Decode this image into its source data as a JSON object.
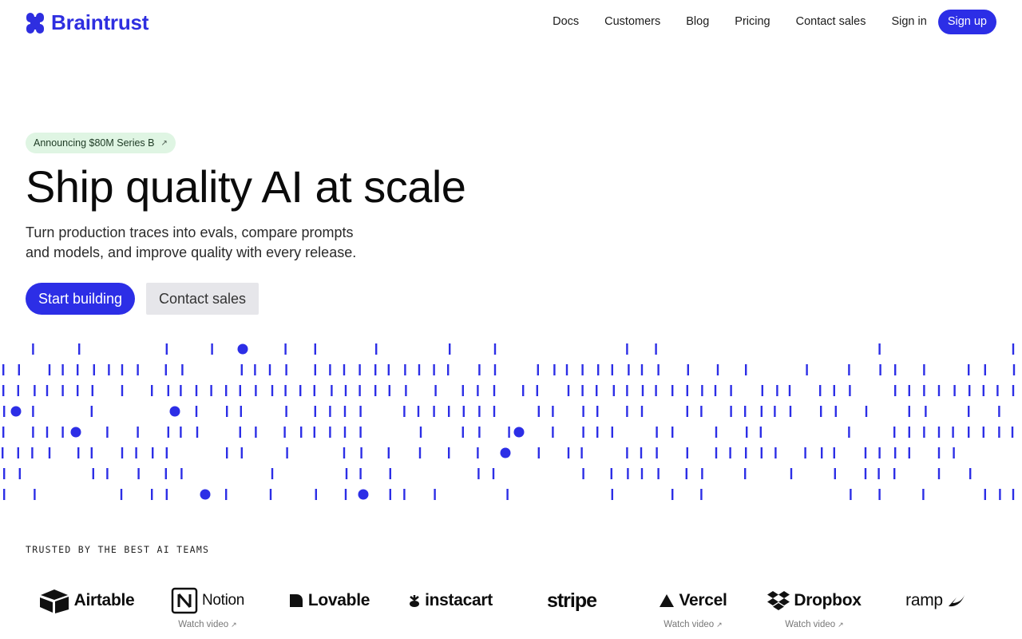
{
  "brand": {
    "name": "Braintrust",
    "color": "#2e2ee0",
    "icon": "braintrust-logo-icon"
  },
  "nav": {
    "links": [
      "Docs",
      "Customers",
      "Blog",
      "Pricing",
      "Contact sales",
      "Sign in"
    ],
    "signup": "Sign up"
  },
  "hero": {
    "announcement": "Announcing $80M Series B",
    "announcement_icon": "arrow-up-right-icon",
    "title": "Ship quality AI at scale",
    "subtitle": "Turn production traces into evals, compare prompts and models, and improve quality with every release.",
    "primary_cta": "Start building",
    "secondary_cta": "Contact sales"
  },
  "trusted": {
    "heading": "TRUSTED BY THE BEST AI TEAMS",
    "logos": [
      {
        "name": "Airtable",
        "icon": "airtable-icon",
        "video": ""
      },
      {
        "name": "Notion",
        "icon": "notion-icon",
        "video": "Watch video"
      },
      {
        "name": "Lovable",
        "icon": "lovable-heart-icon",
        "video": ""
      },
      {
        "name": "instacart",
        "icon": "instacart-carrot-icon",
        "video": ""
      },
      {
        "name": "stripe",
        "icon": "",
        "video": ""
      },
      {
        "name": "Vercel",
        "icon": "vercel-triangle-icon",
        "video": "Watch video"
      },
      {
        "name": "Dropbox",
        "icon": "dropbox-icon",
        "video": "Watch video"
      },
      {
        "name": "ramp",
        "icon": "ramp-icon",
        "video": ""
      }
    ]
  },
  "colors": {
    "accent": "#2c2ee6",
    "announce_bg": "#dff5e3",
    "secondary_bg": "#e6e6ea"
  }
}
